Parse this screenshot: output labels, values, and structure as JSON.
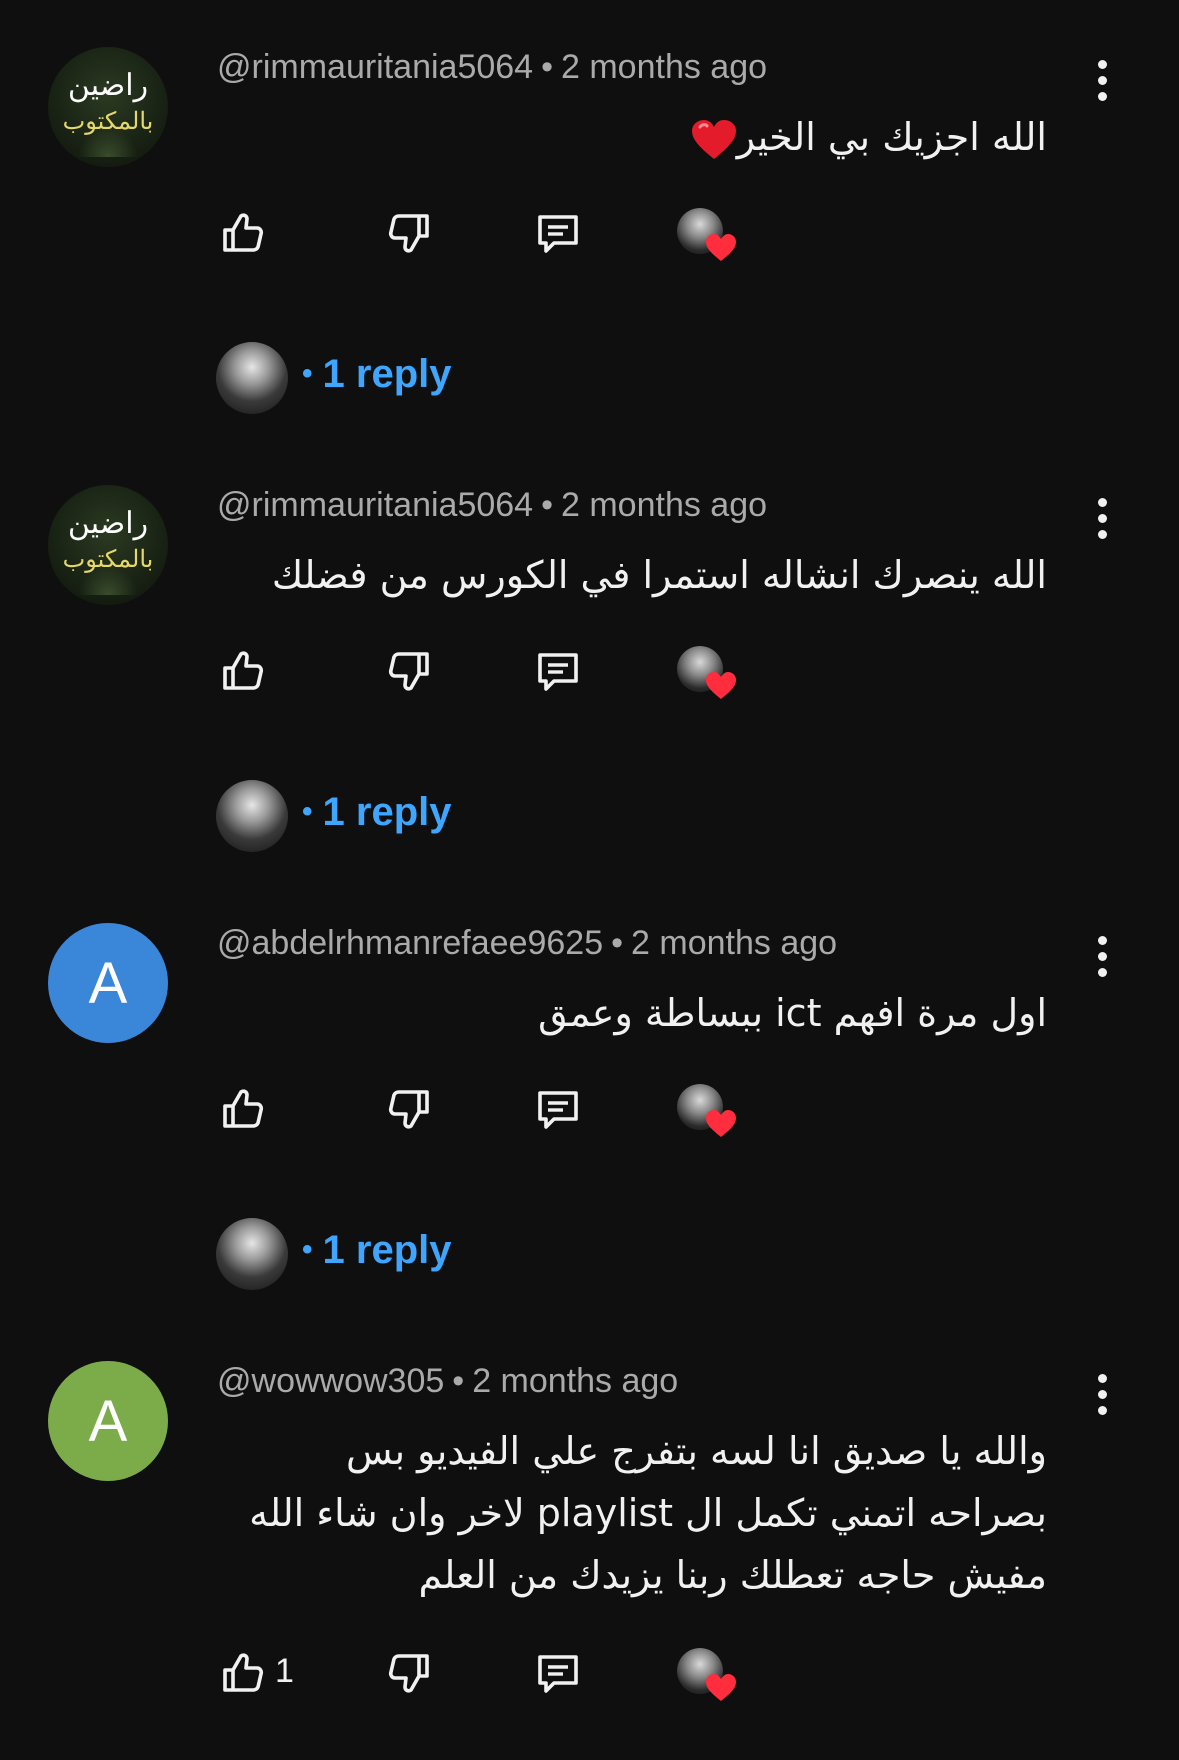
{
  "colors": {
    "background": "#0f0f0f",
    "text": "#f1f1f1",
    "meta": "#aaaaaa",
    "reply_link": "#3ea6ff",
    "heart": "#ff2d3d",
    "avatar_blue": "#3a86d8",
    "avatar_green": "#7cac4a"
  },
  "comments": [
    {
      "author": "@rimmauritania5064",
      "time": "2 months ago",
      "avatar": {
        "type": "image",
        "art_text_top": "راضين",
        "art_text_bottom": "بالمكتوب"
      },
      "lines": [
        "الله اجزيك بي الخير"
      ],
      "emoji": "red-heart",
      "likes": "",
      "replies_label": "1 reply"
    },
    {
      "author": "@rimmauritania5064",
      "time": "2 months ago",
      "avatar": {
        "type": "image",
        "art_text_top": "راضين",
        "art_text_bottom": "بالمكتوب"
      },
      "lines": [
        "الله ينصرك انشاله استمرا في الكورس من فضلك"
      ],
      "likes": "",
      "replies_label": "1 reply"
    },
    {
      "author": "@abdelrhmanrefaee9625",
      "time": "2 months ago",
      "avatar": {
        "type": "letter",
        "letter": "A",
        "color": "#3a86d8"
      },
      "lines": [
        "اول مرة افهم ict  ببساطة وعمق"
      ],
      "likes": "",
      "replies_label": "1 reply"
    },
    {
      "author": "@wowwow305",
      "time": "2 months ago",
      "avatar": {
        "type": "letter",
        "letter": "A",
        "color": "#7cac4a"
      },
      "lines": [
        "والله يا صديق انا لسه بتفرج علي الفيديو بس",
        "بصراحه اتمني تكمل ال playlist لاخر وان شاء الله",
        "مفيش حاجه تعطلك ربنا يزيدك من العلم"
      ],
      "likes": "1",
      "replies_label": ""
    }
  ]
}
